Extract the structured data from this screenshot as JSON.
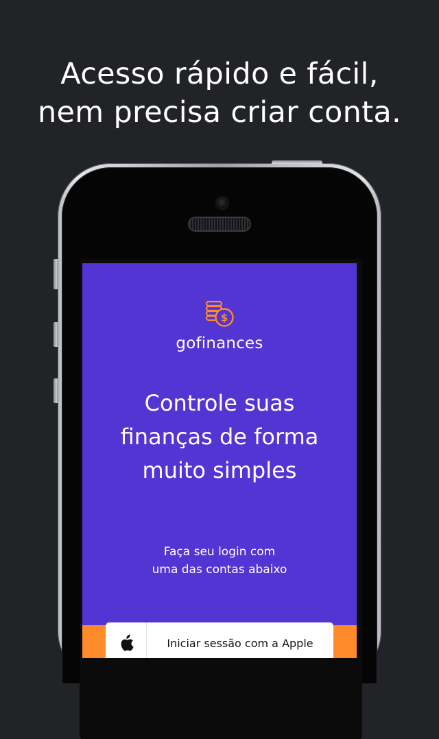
{
  "headline": {
    "line1": "Acesso rápido e fácil,",
    "line2": "nem precisa criar conta."
  },
  "app": {
    "logo_icon": "coins-dollar-icon",
    "brand_name": "gofinances",
    "title": {
      "line1": "Controle suas",
      "line2": "finanças de forma",
      "line3": "muito simples"
    },
    "subtitle": {
      "line1": "Faça seu login com",
      "line2": "uma das contas abaixo"
    },
    "apple_button": {
      "icon": "apple-icon",
      "label": "Iniciar sessão com a Apple"
    }
  },
  "colors": {
    "background": "#222327",
    "primary": "#5335d4",
    "secondary": "#ff8a2a",
    "text_light": "#ffffff",
    "button_bg": "#ffffff"
  }
}
